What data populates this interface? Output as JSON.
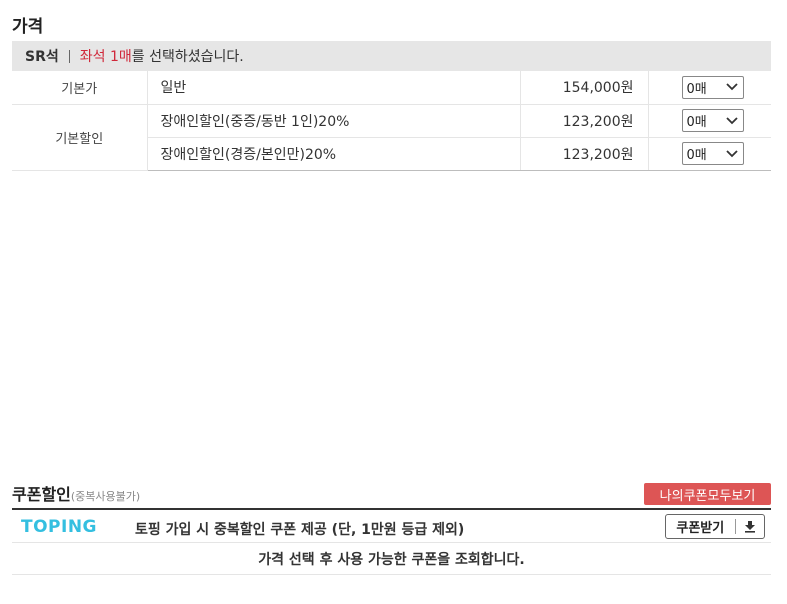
{
  "price_section": {
    "title": "가격",
    "seat": {
      "name": "SR석",
      "count_text": "좌석 1매",
      "suffix": "를 선택하셨습니다."
    },
    "rows": [
      {
        "category": "기본가",
        "name": "일반",
        "amount": "154,000원",
        "qty": "0매"
      },
      {
        "category": "기본할인",
        "name": "장애인할인(중증/동반 1인)20%",
        "amount": "123,200원",
        "qty": "0매"
      },
      {
        "name": "장애인할인(경증/본인만)20%",
        "amount": "123,200원",
        "qty": "0매"
      }
    ]
  },
  "coupon_section": {
    "title": "쿠폰할인",
    "note": "(중복사용불가)",
    "my_coupon_button": "나의쿠폰모두보기",
    "toping": {
      "logo": "TOPING",
      "text": "토핑 가입 시 중복할인 쿠폰 제공 (단, 1만원 등급 제외)",
      "get_button": "쿠폰받기"
    },
    "message": "가격 선택 후 사용 가능한 쿠폰을 조회합니다."
  },
  "colors": {
    "accent_red": "#dd5555",
    "seat_count_red": "#d0283a",
    "toping_blue": "#34bfe0"
  },
  "icons": {
    "select_arrow": "chevron-down-icon",
    "download": "download-icon"
  }
}
